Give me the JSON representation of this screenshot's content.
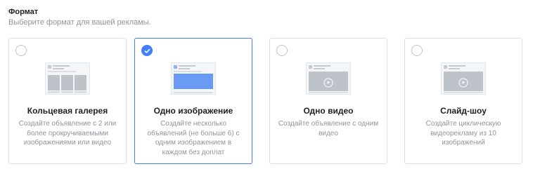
{
  "format": {
    "title": "Формат",
    "subtitle": "Выберите формат для вашей рекламы."
  },
  "cards": [
    {
      "id": "carousel",
      "title": "Кольцевая галерея",
      "description": "Создайте объявление с 2 или более прокручиваемыми изображениями или видео",
      "selected": false
    },
    {
      "id": "single-image",
      "title": "Одно изображение",
      "description": "Создайте несколько объявлений (не больше 6) с одним изображением в каждом без доплат",
      "selected": true
    },
    {
      "id": "single-video",
      "title": "Одно видео",
      "description": "Создайте объявление с одним видео",
      "selected": false
    },
    {
      "id": "slideshow",
      "title": "Слайд-шоу",
      "description": "Создайте циклическую видеорекламу из 10 изображений",
      "selected": false
    }
  ],
  "colors": {
    "accent": "#4080ff",
    "border": "#dddfe2",
    "muted_text": "#90949c"
  },
  "icons": {
    "checked": "checkmark-icon",
    "carousel_preview": "carousel-preview-icon",
    "image_preview": "image-preview-icon",
    "video_preview": "video-play-icon"
  }
}
